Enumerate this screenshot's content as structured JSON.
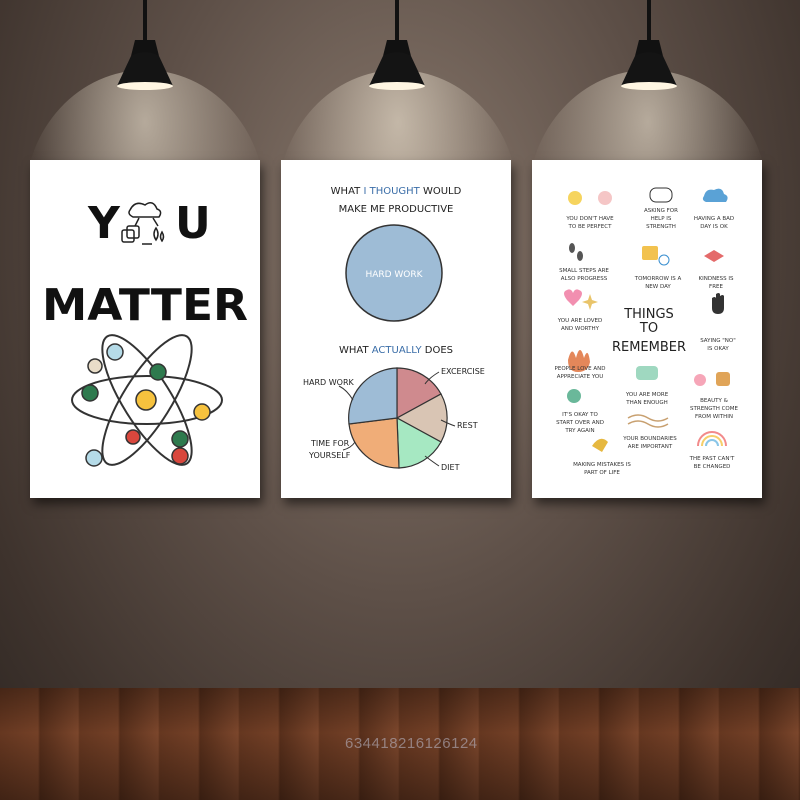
{
  "poster1": {
    "line1_a": "Y",
    "line1_b": "U",
    "line2": "MATTER"
  },
  "poster2": {
    "heading1_a": "WHAT",
    "heading1_b": "I THOUGHT",
    "heading1_c": "WOULD",
    "heading2": "MAKE ME PRODUCTIVE",
    "circle_label": "HARD WORK",
    "heading3_a": "WHAT",
    "heading3_b": "ACTUALLY",
    "heading3_c": "DOES",
    "pie_labels": {
      "hard_work": "HARD WORK",
      "excercise": "EXCERCISE",
      "rest": "REST",
      "diet": "DIET",
      "time_1": "TIME FOR",
      "time_2": "YOURSELF"
    },
    "pie_colors": {
      "hard_work": "#9ebcd6",
      "excercise": "#cf8a8e",
      "rest": "#d9c5b4",
      "diet": "#a6e8c2",
      "time": "#f0ad78"
    }
  },
  "poster3": {
    "title1": "THINGS",
    "title2": "TO",
    "title3": "REMEMBER",
    "items": {
      "a1": "YOU DON'T HAVE",
      "a2": "TO BE PERFECT",
      "b1": "ASKING FOR",
      "b2": "HELP IS",
      "b3": "STRENGTH",
      "c1": "HAVING A BAD",
      "c2": "DAY IS OK",
      "d1": "SMALL STEPS ARE",
      "d2": "ALSO PROGRESS",
      "e1": "TOMORROW IS A",
      "e2": "NEW DAY",
      "f1": "KINDNESS IS",
      "f2": "FREE",
      "g1": "YOU ARE LOVED",
      "g2": "AND WORTHY",
      "h1": "SAYING \"NO\"",
      "h2": "IS OKAY",
      "i1": "PEOPLE LOVE AND",
      "i2": "APPRECIATE YOU",
      "j1": "YOU ARE MORE",
      "j2": "THAN ENOUGH",
      "k1": "BEAUTY &",
      "k2": "STRENGTH COME",
      "k3": "FROM WITHIN",
      "l1": "IT'S OKAY TO",
      "l2": "START OVER AND",
      "l3": "TRY AGAIN",
      "m1": "YOUR BOUNDARIES",
      "m2": "ARE IMPORTANT",
      "n1": "THE PAST CAN'T",
      "n2": "BE CHANGED",
      "o1": "MAKING MISTAKES IS",
      "o2": "PART OF LIFE"
    }
  },
  "watermark": "634418216126124"
}
